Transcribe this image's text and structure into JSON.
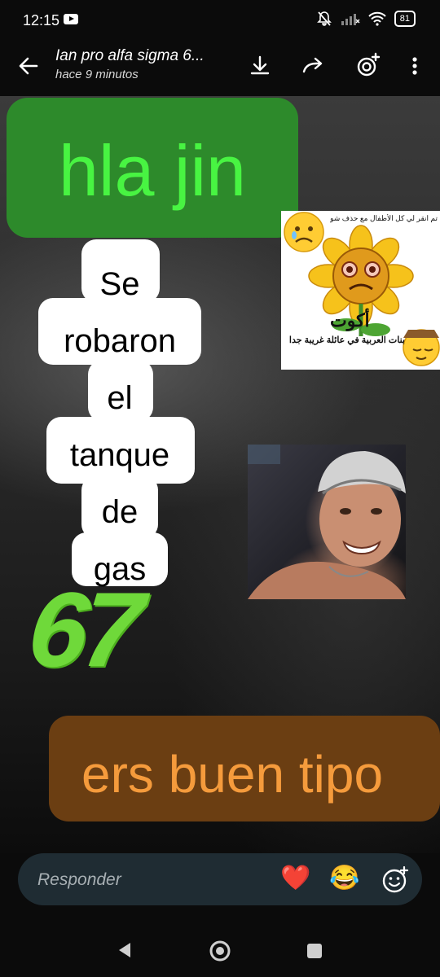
{
  "status": {
    "time": "12:15",
    "battery": "81"
  },
  "header": {
    "title": "Ian pro alfa sigma 6...",
    "subtitle": "hace 9 minutos"
  },
  "story": {
    "green_text": "hla jin",
    "white_lines": [
      "Se",
      "robaron",
      "el",
      "tanque",
      "de",
      "gas"
    ],
    "number_text": "67",
    "brown_text": "ers buen tipo",
    "sticker_sun_text": "بنات العربية في عائلة غريبة جدا",
    "sticker_sun_top_text": "تم انقر لي كل الأطفال مع حذف شوية",
    "sticker_sun_word": "أكوت"
  },
  "reply": {
    "placeholder": "Responder",
    "heart": "❤️",
    "laugh": "😂"
  },
  "colors": {
    "green_bubble": "#2d8a2b",
    "green_text": "#48f442",
    "brown_bubble": "#6b3e12",
    "brown_text": "#f59b3c"
  }
}
